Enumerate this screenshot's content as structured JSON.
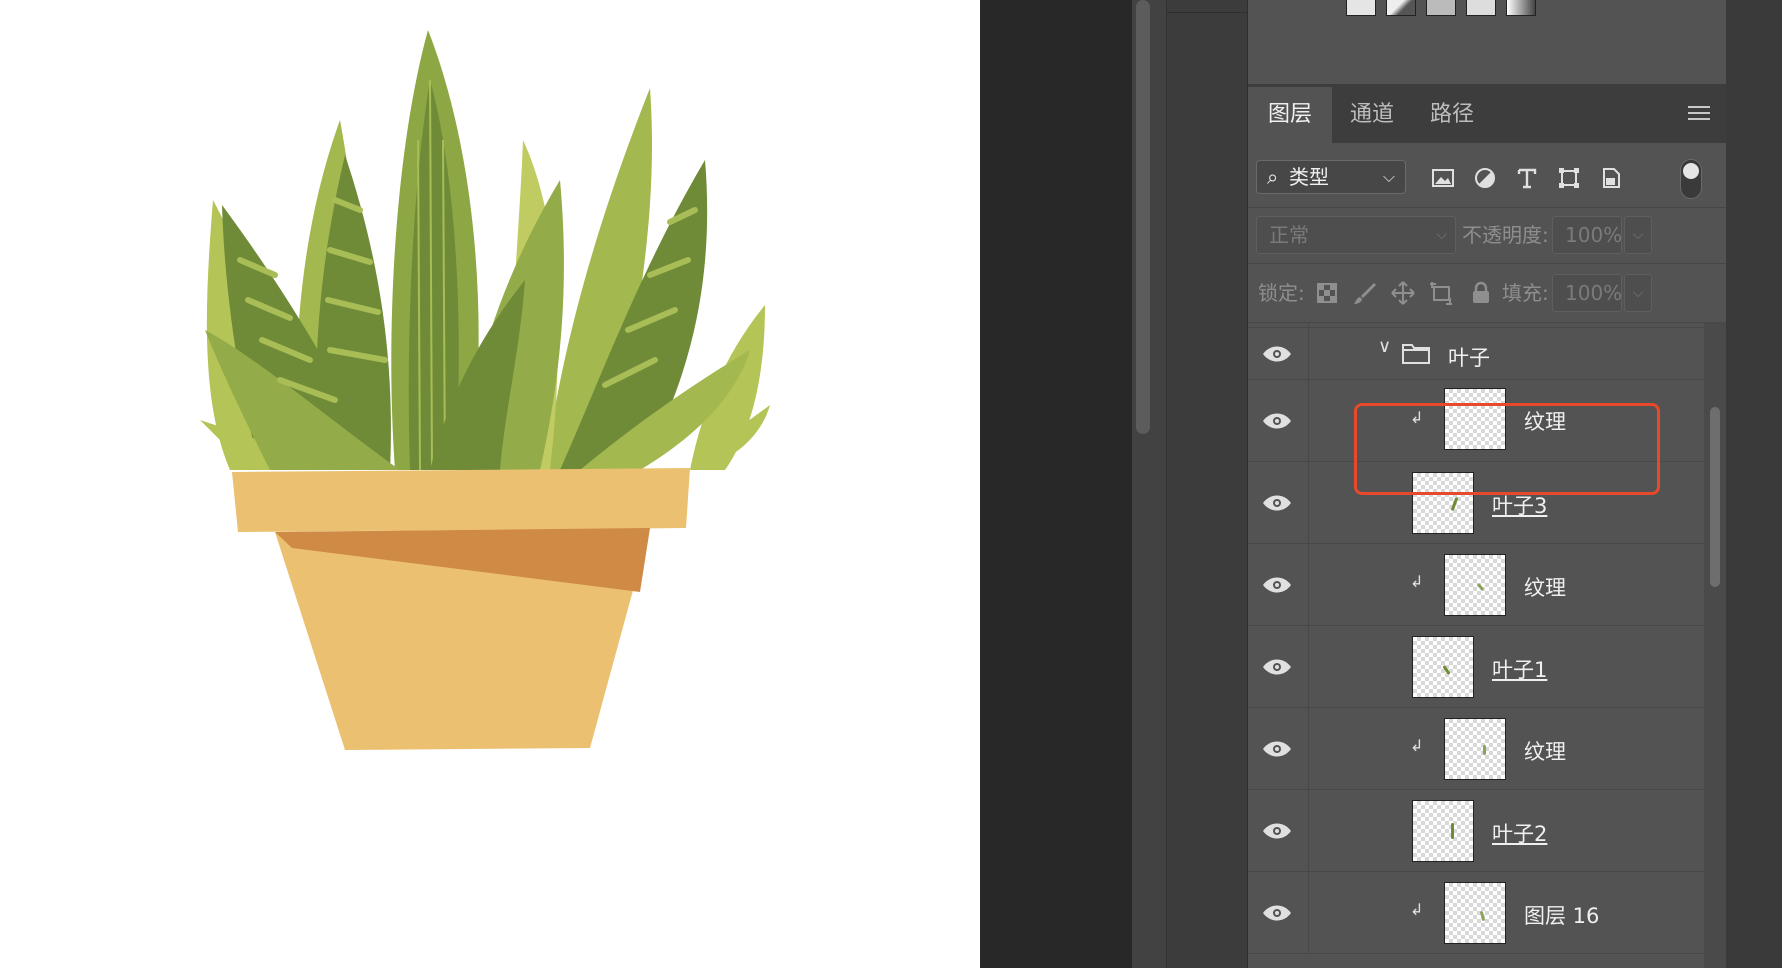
{
  "panel": {
    "tabs": [
      {
        "label": "图层",
        "active": true
      },
      {
        "label": "通道",
        "active": false
      },
      {
        "label": "路径",
        "active": false
      }
    ],
    "filter": {
      "label": "类型"
    },
    "blend_mode": "正常",
    "opacity": {
      "label": "不透明度:",
      "value": "100%"
    },
    "lock": {
      "label": "锁定:"
    },
    "fill": {
      "label": "填充:",
      "value": "100%"
    }
  },
  "layers": [
    {
      "name": "叶子",
      "kind": "group",
      "expanded": true,
      "visible": true
    },
    {
      "name": "纹理",
      "kind": "clipped",
      "visible": true,
      "highlighted": true
    },
    {
      "name": "叶子3",
      "kind": "layer",
      "visible": true
    },
    {
      "name": "纹理",
      "kind": "clipped",
      "visible": true
    },
    {
      "name": "叶子1",
      "kind": "layer",
      "visible": true
    },
    {
      "name": "纹理",
      "kind": "clipped",
      "visible": true
    },
    {
      "name": "叶子2",
      "kind": "layer",
      "visible": true
    },
    {
      "name": "图层 16",
      "kind": "clipped",
      "visible": true
    }
  ],
  "colors": {
    "panel_bg": "#535353",
    "highlight": "#e8492a",
    "pot_main": "#ecc071",
    "pot_band": "#cf8b45",
    "leaf_light": "#b4c456",
    "leaf_mid": "#93ab48",
    "leaf_dark": "#6f8b38"
  }
}
